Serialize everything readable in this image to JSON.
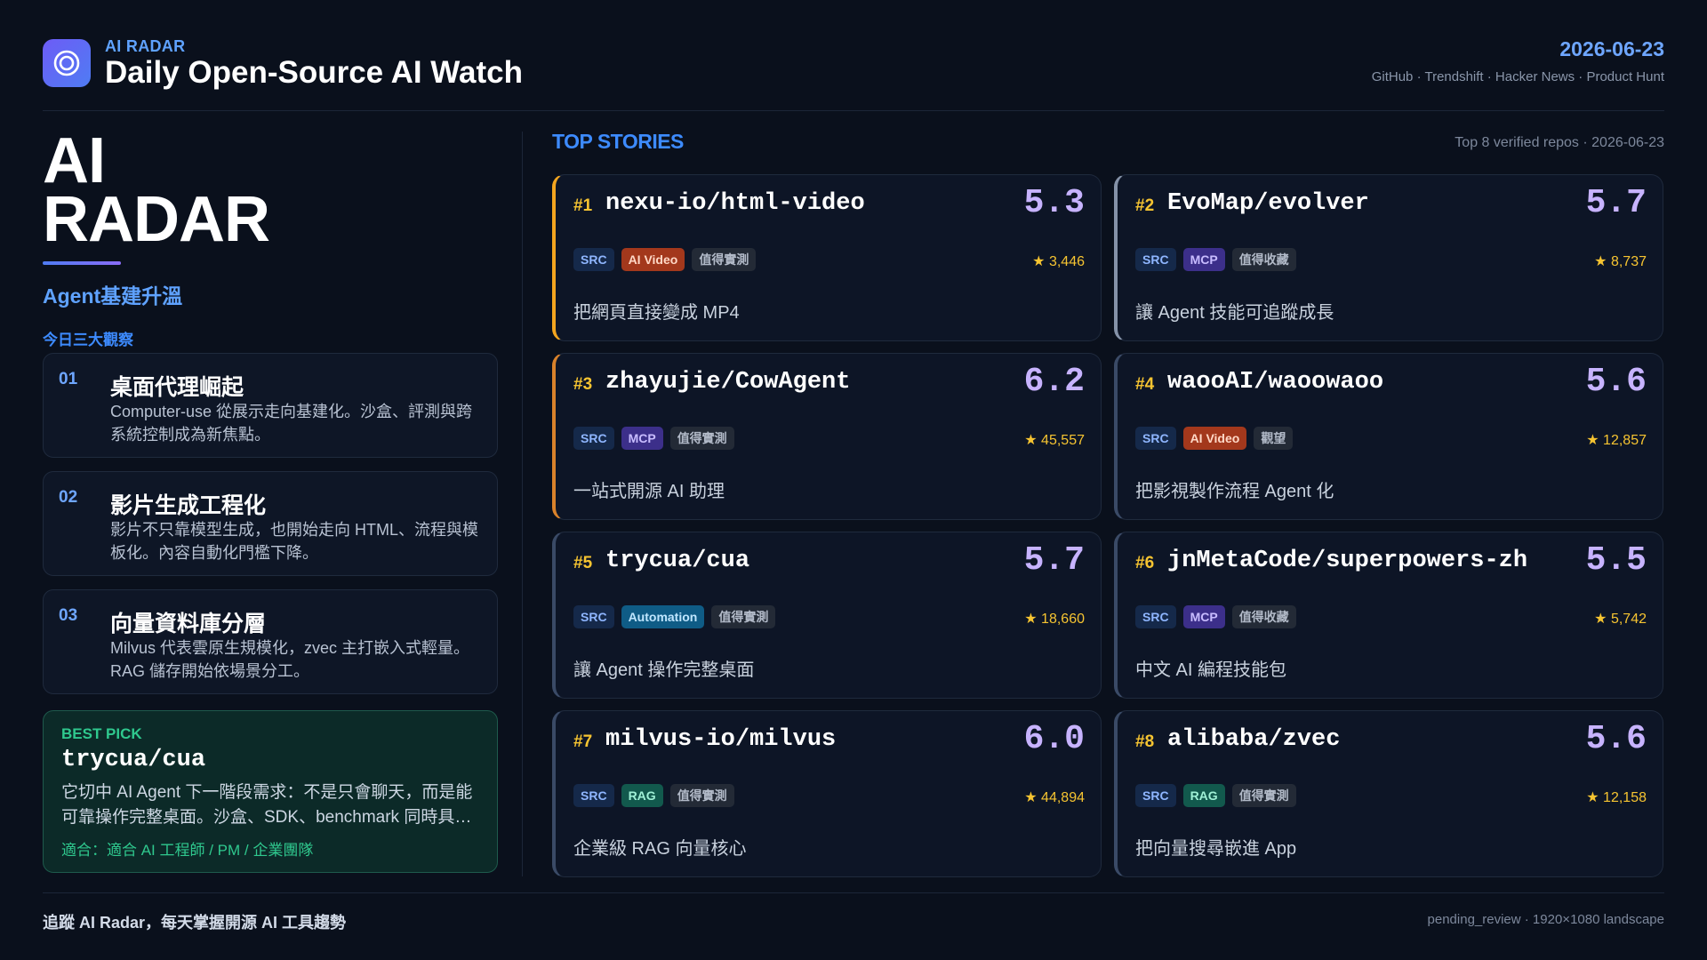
{
  "header": {
    "kicker": "AI RADAR",
    "title": "Daily Open-Source AI Watch",
    "date": "2026-06-23",
    "sources": "GitHub · Trendshift · Hacker News · Product Hunt"
  },
  "left": {
    "hero_line1": "AI",
    "hero_line2": "RADAR",
    "theme": "Agent基建升溫",
    "observations_label": "今日三大觀察",
    "observations": [
      {
        "num": "01",
        "title": "桌面代理崛起",
        "body": "Computer-use 從展示走向基建化。沙盒、評測與跨系統控制成為新焦點。"
      },
      {
        "num": "02",
        "title": "影片生成工程化",
        "body": "影片不只靠模型生成，也開始走向 HTML、流程與模板化。內容自動化門檻下降。"
      },
      {
        "num": "03",
        "title": "向量資料庫分層",
        "body": "Milvus 代表雲原生規模化，zvec 主打嵌入式輕量。RAG 儲存開始依場景分工。"
      }
    ],
    "best_pick": {
      "kicker": "BEST PICK",
      "name": "trycua/cua",
      "body": "它切中 AI Agent 下一階段需求：不是只會聊天，而是能可靠操作完整桌面。沙盒、SDK、benchmark 同時具…",
      "fit": "適合：適合 AI 工程師 / PM / 企業團隊"
    }
  },
  "top_stories": {
    "title": "TOP STORIES",
    "meta": "Top 8 verified repos · 2026-06-23",
    "cards": [
      {
        "rank": "#1",
        "name": "nexu-io/html-video",
        "score": "5.3",
        "tags": [
          {
            "label": "SRC",
            "kind": "src"
          },
          {
            "label": "AI Video",
            "kind": "video"
          },
          {
            "label": "值得實測",
            "kind": "note"
          }
        ],
        "stars": "★ 3,446",
        "desc": "把網頁直接變成 MP4",
        "accent": "gold"
      },
      {
        "rank": "#2",
        "name": "EvoMap/evolver",
        "score": "5.7",
        "tags": [
          {
            "label": "SRC",
            "kind": "src"
          },
          {
            "label": "MCP",
            "kind": "mcp"
          },
          {
            "label": "值得收藏",
            "kind": "note"
          }
        ],
        "stars": "★ 8,737",
        "desc": "讓 Agent 技能可追蹤成長",
        "accent": "silver"
      },
      {
        "rank": "#3",
        "name": "zhayujie/CowAgent",
        "score": "6.2",
        "tags": [
          {
            "label": "SRC",
            "kind": "src"
          },
          {
            "label": "MCP",
            "kind": "mcp"
          },
          {
            "label": "值得實測",
            "kind": "note"
          }
        ],
        "stars": "★ 45,557",
        "desc": "一站式開源 AI 助理",
        "accent": "orange"
      },
      {
        "rank": "#4",
        "name": "waooAI/waoowaoo",
        "score": "5.6",
        "tags": [
          {
            "label": "SRC",
            "kind": "src"
          },
          {
            "label": "AI Video",
            "kind": "video"
          },
          {
            "label": "觀望",
            "kind": "note"
          }
        ],
        "stars": "★ 12,857",
        "desc": "把影視製作流程 Agent 化",
        "accent": "plain"
      },
      {
        "rank": "#5",
        "name": "trycua/cua",
        "score": "5.7",
        "tags": [
          {
            "label": "SRC",
            "kind": "src"
          },
          {
            "label": "Automation",
            "kind": "auto"
          },
          {
            "label": "值得實測",
            "kind": "note"
          }
        ],
        "stars": "★ 18,660",
        "desc": "讓 Agent 操作完整桌面",
        "accent": "plain"
      },
      {
        "rank": "#6",
        "name": "jnMetaCode/superpowers-zh",
        "score": "5.5",
        "tags": [
          {
            "label": "SRC",
            "kind": "src"
          },
          {
            "label": "MCP",
            "kind": "mcp"
          },
          {
            "label": "值得收藏",
            "kind": "note"
          }
        ],
        "stars": "★ 5,742",
        "desc": "中文 AI 編程技能包",
        "accent": "plain"
      },
      {
        "rank": "#7",
        "name": "milvus-io/milvus",
        "score": "6.0",
        "tags": [
          {
            "label": "SRC",
            "kind": "src"
          },
          {
            "label": "RAG",
            "kind": "rag"
          },
          {
            "label": "值得實測",
            "kind": "note"
          }
        ],
        "stars": "★ 44,894",
        "desc": "企業級 RAG 向量核心",
        "accent": "plain"
      },
      {
        "rank": "#8",
        "name": "alibaba/zvec",
        "score": "5.6",
        "tags": [
          {
            "label": "SRC",
            "kind": "src"
          },
          {
            "label": "RAG",
            "kind": "rag"
          },
          {
            "label": "值得實測",
            "kind": "note"
          }
        ],
        "stars": "★ 12,158",
        "desc": "把向量搜尋嵌進 App",
        "accent": "plain"
      }
    ]
  },
  "footer": {
    "left": "追蹤 AI Radar，每天掌握開源 AI 工具趨勢",
    "right": "pending_review · 1920×1080 landscape"
  },
  "colors": {
    "background": "#0a101c",
    "accent_blue": "#3d8bff",
    "score": "#c7b3ff",
    "rank": "#f6c431",
    "best_pick": "#2fc88e"
  },
  "icons": {
    "logo": "radar-ring-icon"
  }
}
